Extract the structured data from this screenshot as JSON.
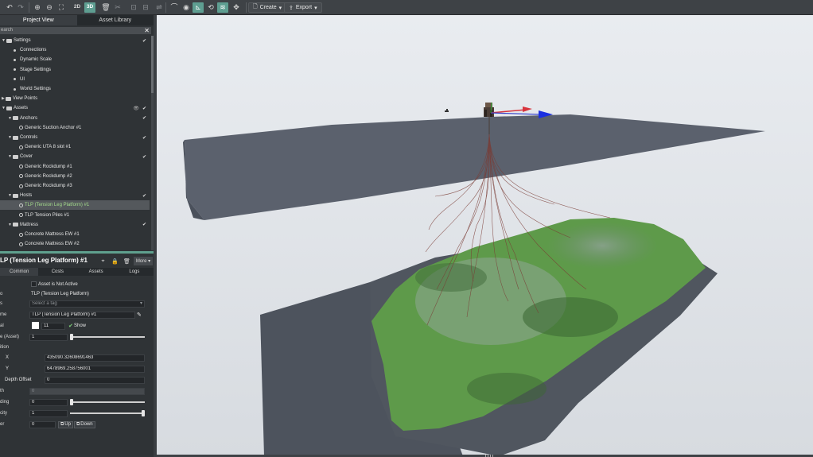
{
  "toolbar": {
    "icons": [
      "undo-icon",
      "redo-icon",
      "zoom-in-icon",
      "zoom-out-icon",
      "fit-view-icon",
      "view-2d",
      "view-3d",
      "delete-icon",
      "cut-icon",
      "crop-icon",
      "align-icon",
      "flip-icon",
      "water-surface-icon",
      "visibility-icon",
      "seabed-icon",
      "axes-icon",
      "orbit-icon",
      "layers-icon",
      "move-icon"
    ],
    "view_2d": "2D",
    "view_3d": "3D",
    "create_label": "Create",
    "export_label": "Export",
    "accent": "#5e9e91"
  },
  "panel": {
    "tab_project": "Project View",
    "tab_library": "Asset Library",
    "search_placeholder": "earch"
  },
  "tree": [
    {
      "label": "Settings",
      "kind": "folder",
      "check": "✔"
    },
    {
      "label": "Connections",
      "kind": "item"
    },
    {
      "label": "Dynamic Scale",
      "kind": "item"
    },
    {
      "label": "Stage Settings",
      "kind": "item"
    },
    {
      "label": "UI",
      "kind": "item"
    },
    {
      "label": "World Settings",
      "kind": "item"
    },
    {
      "label": "View Points",
      "kind": "folder"
    },
    {
      "label": "Assets",
      "kind": "folder",
      "check": "✔",
      "vis": "👁"
    },
    {
      "label": "Anchors",
      "kind": "folder",
      "check": "✔"
    },
    {
      "label": "Generic Suction Anchor #1",
      "kind": "asset"
    },
    {
      "label": "Controls",
      "kind": "folder",
      "check": "✔"
    },
    {
      "label": "Generic UTA 8 slot #1",
      "kind": "asset"
    },
    {
      "label": "Cover",
      "kind": "folder",
      "check": "✔"
    },
    {
      "label": "Generic Rockdump #1",
      "kind": "asset"
    },
    {
      "label": "Generic Rockdump #2",
      "kind": "asset"
    },
    {
      "label": "Generic Rockdump #3",
      "kind": "asset"
    },
    {
      "label": "Hosts",
      "kind": "folder",
      "check": "✔"
    },
    {
      "label": "TLP (Tension Leg Platform) #1",
      "kind": "asset",
      "selected": true
    },
    {
      "label": "TLP Tension Piles #1",
      "kind": "asset"
    },
    {
      "label": "Mattress",
      "kind": "folder",
      "check": "✔"
    },
    {
      "label": "Concrete Mattress EW #1",
      "kind": "asset"
    },
    {
      "label": "Concrete Mattress EW #2",
      "kind": "asset"
    }
  ],
  "props": {
    "title": "LP (Tension Leg Platform) #1",
    "more_label": "More",
    "tabs": [
      "Common",
      "Costs",
      "Assets",
      "Logs"
    ],
    "not_active_label": "Asset is Not Active",
    "type_value": "TLP (Tension Leg Platform)",
    "tag_placeholder": "Select a tag",
    "name_value": "TLP (Tension Leg Platform) #1",
    "color_index": "11",
    "show_label": "Show",
    "scale_label": "e (Asset)",
    "scale_value": "1",
    "position_label": "ition",
    "x_label": "X",
    "x_value": "435090.32608691463",
    "y_label": "Y",
    "y_value": "6478969.258756001",
    "depth_offset_label": "Depth Offset",
    "depth_offset_value": "0",
    "depth_label": "th",
    "depth_value": "0",
    "heading_label": "ding",
    "heading_value": "0",
    "opacity_label": "city",
    "opacity_value": "1",
    "layer_label": "er",
    "layer_value": "0",
    "up_label": "Up",
    "down_label": "Down",
    "label_o": "o",
    "label_s": "s",
    "label_me": "me",
    "label_l": "al"
  }
}
